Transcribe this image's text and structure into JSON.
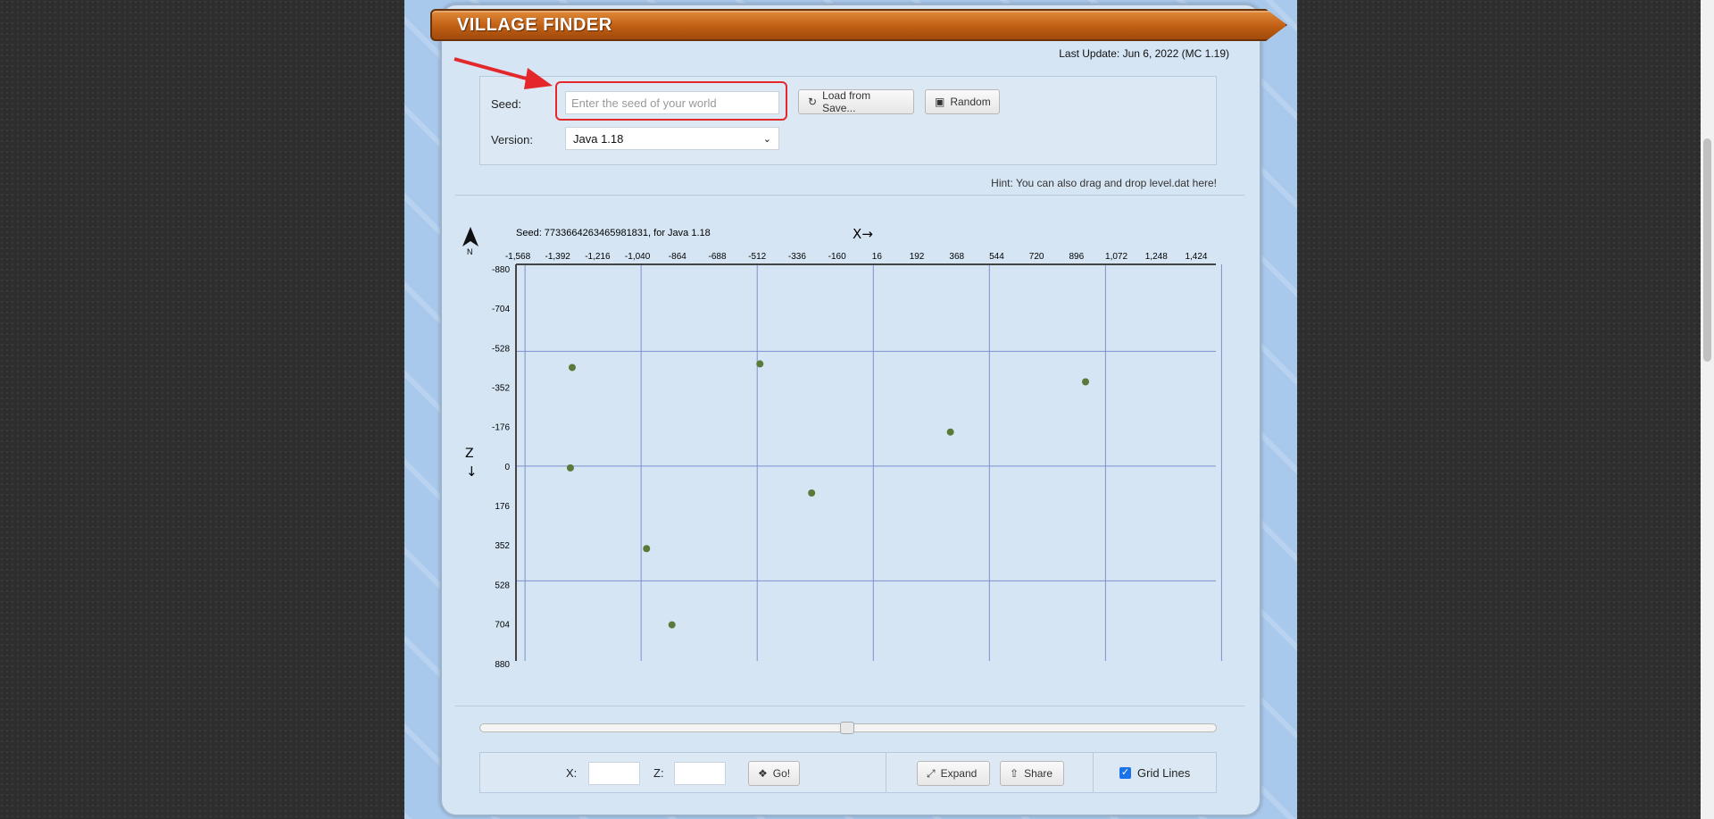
{
  "header": {
    "title": "VILLAGE FINDER",
    "last_update": "Last Update: Jun 6, 2022 (MC 1.19)"
  },
  "form": {
    "seed_label": "Seed:",
    "seed_placeholder": "Enter the seed of your world",
    "load_button": "Load from Save...",
    "random_button": "Random",
    "version_label": "Version:",
    "version_selected": "Java 1.18",
    "hint": "Hint: You can also drag and drop level.dat here!"
  },
  "map": {
    "caption": "Seed: 7733664263465981831, for Java 1.18",
    "x_axis_label": "X→",
    "z_axis_label_top": "Z",
    "z_axis_label_arrow": "↓",
    "compass_letter": "N",
    "x_ticks": [
      "-1,568",
      "-1,392",
      "-1,216",
      "-1,040",
      "-864",
      "-688",
      "-512",
      "-336",
      "-160",
      "16",
      "192",
      "368",
      "544",
      "720",
      "896",
      "1,072",
      "1,248",
      "1,424"
    ],
    "z_ticks": [
      "-880",
      "-704",
      "-528",
      "-352",
      "-176",
      "0",
      "176",
      "352",
      "528",
      "704",
      "880"
    ],
    "villages": [
      {
        "x": -1328,
        "z": -440
      },
      {
        "x": -1336,
        "z": 8
      },
      {
        "x": -1000,
        "z": 368
      },
      {
        "x": -888,
        "z": 708
      },
      {
        "x": -500,
        "z": -456
      },
      {
        "x": -272,
        "z": 120
      },
      {
        "x": 340,
        "z": -152
      },
      {
        "x": 936,
        "z": -376
      }
    ],
    "marker_color": "#5a7a3a"
  },
  "controls": {
    "x_label": "X:",
    "z_label": "Z:",
    "go_button": "Go!",
    "expand_button": "Expand",
    "share_button": "Share",
    "grid_lines_label": "Grid Lines",
    "grid_lines_checked": true,
    "zoom_slider_fraction": 0.5
  }
}
